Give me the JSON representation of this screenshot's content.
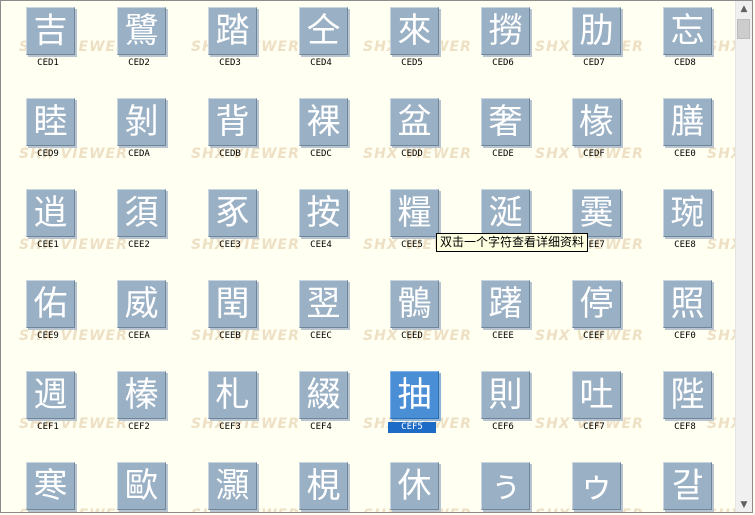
{
  "watermark_text": "SHX VIEWER",
  "tooltip": "双击一个字符查看详细资料",
  "scrollbar": {
    "up_icon": "▲",
    "down_icon": "▼"
  },
  "selected_code": "CEF5",
  "rows": [
    [
      {
        "glyph": "吉",
        "code": "CED1"
      },
      {
        "glyph": "鷺",
        "code": "CED2"
      },
      {
        "glyph": "踏",
        "code": "CED3"
      },
      {
        "glyph": "仝",
        "code": "CED4"
      },
      {
        "glyph": "來",
        "code": "CED5"
      },
      {
        "glyph": "撈",
        "code": "CED6"
      },
      {
        "glyph": "肋",
        "code": "CED7"
      },
      {
        "glyph": "忘",
        "code": "CED8"
      }
    ],
    [
      {
        "glyph": "睦",
        "code": "CED9"
      },
      {
        "glyph": "剝",
        "code": "CEDA"
      },
      {
        "glyph": "背",
        "code": "CEDB"
      },
      {
        "glyph": "裸",
        "code": "CEDC"
      },
      {
        "glyph": "盆",
        "code": "CEDD"
      },
      {
        "glyph": "奢",
        "code": "CEDE"
      },
      {
        "glyph": "椽",
        "code": "CEDF"
      },
      {
        "glyph": "膳",
        "code": "CEE0"
      }
    ],
    [
      {
        "glyph": "逍",
        "code": "CEE1"
      },
      {
        "glyph": "須",
        "code": "CEE2"
      },
      {
        "glyph": "豖",
        "code": "CEE3"
      },
      {
        "glyph": "按",
        "code": "CEE4"
      },
      {
        "glyph": "糧",
        "code": "CEE5"
      },
      {
        "glyph": "涎",
        "code": "CEE6"
      },
      {
        "glyph": "霙",
        "code": "CEE7"
      },
      {
        "glyph": "琬",
        "code": "CEE8"
      }
    ],
    [
      {
        "glyph": "佑",
        "code": "CEE9"
      },
      {
        "glyph": "威",
        "code": "CEEA"
      },
      {
        "glyph": "閏",
        "code": "CEEB"
      },
      {
        "glyph": "翌",
        "code": "CEEC"
      },
      {
        "glyph": "鶻",
        "code": "CEED"
      },
      {
        "glyph": "躇",
        "code": "CEEE"
      },
      {
        "glyph": "停",
        "code": "CEEF"
      },
      {
        "glyph": "照",
        "code": "CEF0"
      }
    ],
    [
      {
        "glyph": "週",
        "code": "CEF1"
      },
      {
        "glyph": "榛",
        "code": "CEF2"
      },
      {
        "glyph": "札",
        "code": "CEF3"
      },
      {
        "glyph": "綴",
        "code": "CEF4"
      },
      {
        "glyph": "抽",
        "code": "CEF5"
      },
      {
        "glyph": "則",
        "code": "CEF6"
      },
      {
        "glyph": "吐",
        "code": "CEF7"
      },
      {
        "glyph": "陛",
        "code": "CEF8"
      }
    ],
    [
      {
        "glyph": "寒",
        "code": ""
      },
      {
        "glyph": "歐",
        "code": ""
      },
      {
        "glyph": "灝",
        "code": ""
      },
      {
        "glyph": "梘",
        "code": ""
      },
      {
        "glyph": "休",
        "code": ""
      },
      {
        "glyph": "ぅ",
        "code": ""
      },
      {
        "glyph": "ゥ",
        "code": ""
      },
      {
        "glyph": "갈",
        "code": ""
      }
    ]
  ]
}
